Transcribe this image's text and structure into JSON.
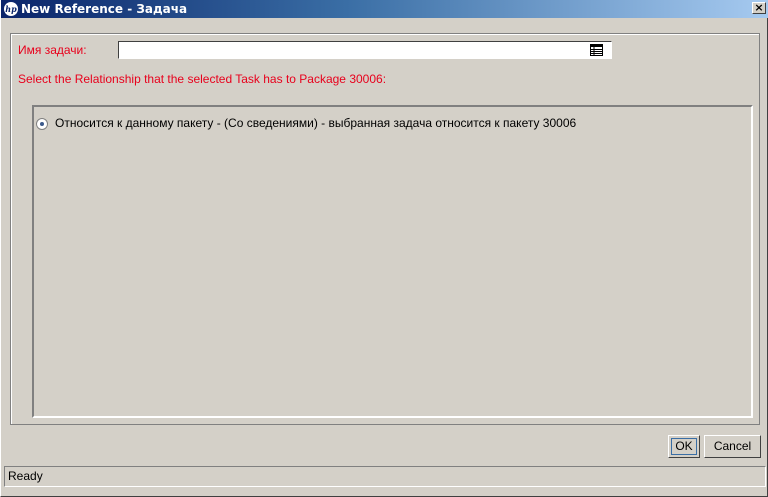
{
  "window": {
    "title": "New Reference - Задача",
    "logo_text": "hp",
    "close_symbol": "×"
  },
  "form": {
    "task_name_label": "Имя задачи:",
    "task_name_value": "",
    "lookup_icon": "list-lookup-icon",
    "relationship_prompt": "Select the Relationship that the selected Task has to Package 30006:"
  },
  "relationships": {
    "options": [
      {
        "label": "Относится к данному пакету - (Со сведениями) - выбранная задача относится к пакету 30006",
        "selected": true
      }
    ]
  },
  "buttons": {
    "ok_label": "OK",
    "cancel_label": "Cancel"
  },
  "status": {
    "text": "Ready"
  },
  "colors": {
    "label_red": "#e8001c",
    "dialog_bg": "#d4d0c8",
    "title_dark": "#0a246a",
    "title_light": "#a6caf0"
  }
}
